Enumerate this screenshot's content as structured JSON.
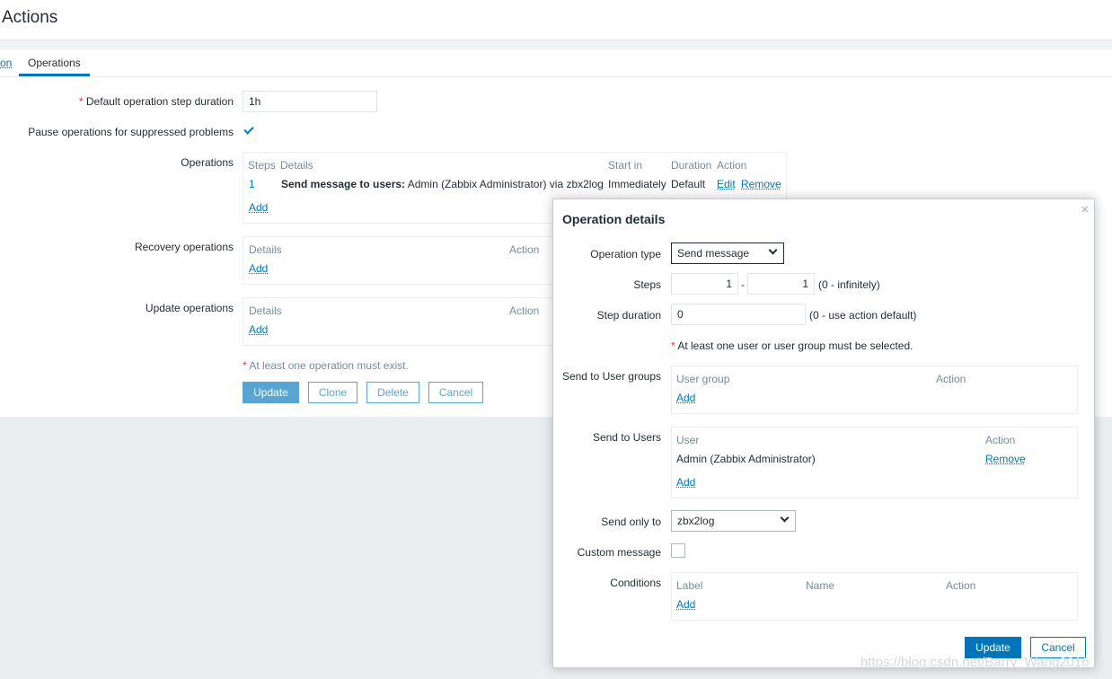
{
  "page": {
    "title": "Actions"
  },
  "tabs": [
    {
      "label": "on"
    },
    {
      "label": "Operations"
    }
  ],
  "form": {
    "step_duration": {
      "label": "Default operation step duration",
      "value": "1h"
    },
    "pause_label": "Pause operations for suppressed problems",
    "pause_checked": true,
    "operations": {
      "label": "Operations",
      "headers": [
        "Steps",
        "Details",
        "Start in",
        "Duration",
        "Action"
      ],
      "rows": [
        {
          "steps": "1",
          "details_bold": "Send message to users:",
          "details_rest": "Admin (Zabbix Administrator) via zbx2log",
          "start_in": "Immediately",
          "duration": "Default",
          "edit": "Edit",
          "remove": "Remove"
        }
      ],
      "add": "Add"
    },
    "recovery": {
      "label": "Recovery operations",
      "headers": [
        "Details",
        "Action"
      ],
      "add": "Add"
    },
    "update_ops": {
      "label": "Update operations",
      "headers": [
        "Details",
        "Action"
      ],
      "add": "Add"
    },
    "note": "At least one operation must exist.",
    "buttons": {
      "update": "Update",
      "clone": "Clone",
      "delete": "Delete",
      "cancel": "Cancel"
    }
  },
  "dialog": {
    "title": "Operation details",
    "close": "×",
    "operation_type": {
      "label": "Operation type",
      "value": "Send message"
    },
    "steps": {
      "label": "Steps",
      "from": "1",
      "sep": "-",
      "to": "1",
      "hint": "(0 - infinitely)"
    },
    "step_duration": {
      "label": "Step duration",
      "value": "0",
      "hint": "(0 - use action default)"
    },
    "note": "At least one user or user group must be selected.",
    "user_groups": {
      "label": "Send to User groups",
      "headers": [
        "User group",
        "Action"
      ],
      "add": "Add"
    },
    "users": {
      "label": "Send to Users",
      "headers": [
        "User",
        "Action"
      ],
      "rows": [
        {
          "user": "Admin (Zabbix Administrator)",
          "remove": "Remove"
        }
      ],
      "add": "Add"
    },
    "send_only_to": {
      "label": "Send only to",
      "value": "zbx2log"
    },
    "custom_message": {
      "label": "Custom message",
      "checked": false
    },
    "conditions": {
      "label": "Conditions",
      "headers": [
        "Label",
        "Name",
        "Action"
      ],
      "add": "Add"
    },
    "buttons": {
      "update": "Update",
      "cancel": "Cancel"
    }
  },
  "watermark": "https://blog.csdn.net/Barry_Wang2016"
}
